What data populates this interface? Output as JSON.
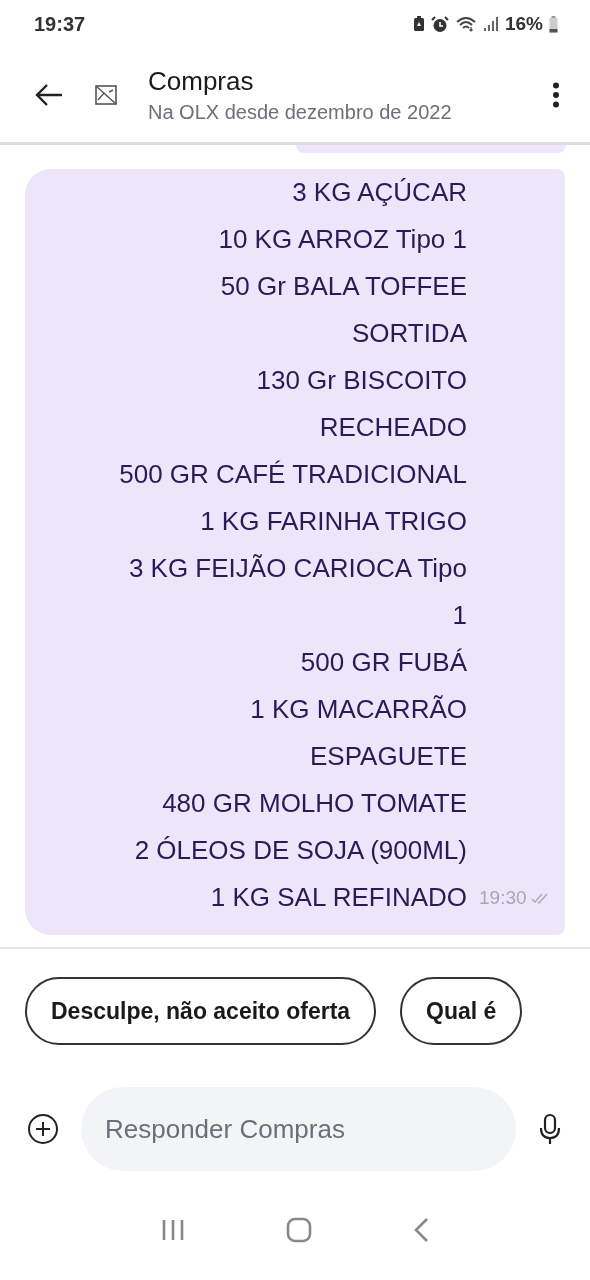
{
  "status_bar": {
    "time": "19:37",
    "battery": "16%"
  },
  "header": {
    "title": "Compras",
    "subtitle": "Na OLX desde dezembro de 2022"
  },
  "message": {
    "lines": [
      "3 KG AÇÚCAR",
      "10 KG ARROZ Tipo 1",
      "50 Gr BALA TOFFEE",
      "SORTIDA",
      "130 Gr BISCOITO",
      "RECHEADO",
      "500 GR CAFÉ TRADICIONAL",
      "1 KG FARINHA TRIGO",
      "3 KG FEIJÃO CARIOCA Tipo",
      "1",
      "500 GR FUBÁ",
      "1 KG MACARRÃO",
      "ESPAGUETE",
      "480 GR MOLHO TOMATE",
      "2 ÓLEOS DE SOJA (900ML)",
      "1 KG SAL REFINADO"
    ],
    "time": "19:30",
    "read": true
  },
  "quick_replies": [
    "Desculpe, não aceito oferta",
    "Qual é"
  ],
  "composer": {
    "placeholder": "Responder Compras"
  }
}
